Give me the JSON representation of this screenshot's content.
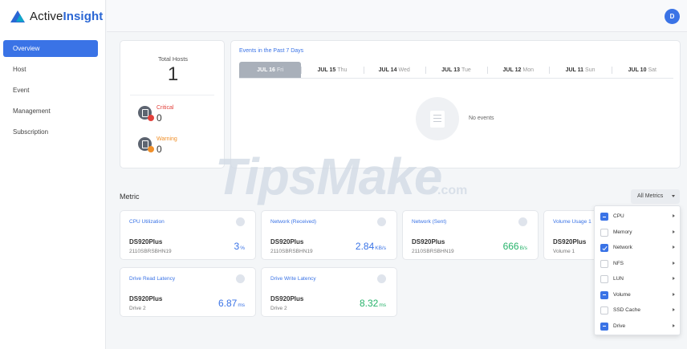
{
  "brand": {
    "name_part1": "Active",
    "name_part2": "Insight"
  },
  "sidebar": {
    "items": [
      {
        "label": "Overview",
        "active": true
      },
      {
        "label": "Host",
        "active": false
      },
      {
        "label": "Event",
        "active": false
      },
      {
        "label": "Management",
        "active": false
      },
      {
        "label": "Subscription",
        "active": false
      }
    ]
  },
  "topbar": {
    "avatar_initial": "D"
  },
  "hosts": {
    "total_label": "Total Hosts",
    "total_value": "1",
    "critical_label": "Critical",
    "critical_value": "0",
    "warning_label": "Warning",
    "warning_value": "0"
  },
  "events": {
    "title": "Events in the Past 7 Days",
    "days": [
      {
        "date": "JUL 16",
        "weekday": "Fri",
        "active": true
      },
      {
        "date": "JUL 15",
        "weekday": "Thu",
        "active": false
      },
      {
        "date": "JUL 14",
        "weekday": "Wed",
        "active": false
      },
      {
        "date": "JUL 13",
        "weekday": "Tue",
        "active": false
      },
      {
        "date": "JUL 12",
        "weekday": "Mon",
        "active": false
      },
      {
        "date": "JUL 11",
        "weekday": "Sun",
        "active": false
      },
      {
        "date": "JUL 10",
        "weekday": "Sat",
        "active": false
      }
    ],
    "empty_text": "No events"
  },
  "watermark": {
    "text": "TipsMake",
    "suffix": ".com"
  },
  "metric": {
    "title": "Metric",
    "all_metrics_label": "All Metrics",
    "cards": [
      {
        "title": "CPU Utilization",
        "host": "DS920Plus",
        "sub": "2110SBRSBHN19",
        "value": "3",
        "unit": "%",
        "color": "#3a73e6"
      },
      {
        "title": "Network (Received)",
        "host": "DS920Plus",
        "sub": "2110SBRSBHN19",
        "value": "2.84",
        "unit": "KB/s",
        "color": "#3a73e6"
      },
      {
        "title": "Network (Sent)",
        "host": "DS920Plus",
        "sub": "2110SBRSBHN19",
        "value": "666",
        "unit": "B/s",
        "color": "#27b36b"
      },
      {
        "title": "Volume Usage 1",
        "host": "DS920Plus",
        "sub": "Volume 1",
        "value": "",
        "unit": "",
        "color": "#3a73e6"
      },
      {
        "title": "Drive Read Latency",
        "host": "DS920Plus",
        "sub": "Drive 2",
        "value": "6.87",
        "unit": "ms",
        "color": "#3a73e6"
      },
      {
        "title": "Drive Write Latency",
        "host": "DS920Plus",
        "sub": "Drive 2",
        "value": "8.32",
        "unit": "ms",
        "color": "#27b36b"
      }
    ]
  },
  "metric_menu": {
    "items": [
      {
        "label": "CPU",
        "state": "partial"
      },
      {
        "label": "Memory",
        "state": "unchecked"
      },
      {
        "label": "Network",
        "state": "checked"
      },
      {
        "label": "NFS",
        "state": "unchecked"
      },
      {
        "label": "LUN",
        "state": "unchecked"
      },
      {
        "label": "Volume",
        "state": "partial"
      },
      {
        "label": "SSD Cache",
        "state": "unchecked"
      },
      {
        "label": "Drive",
        "state": "partial"
      }
    ]
  }
}
